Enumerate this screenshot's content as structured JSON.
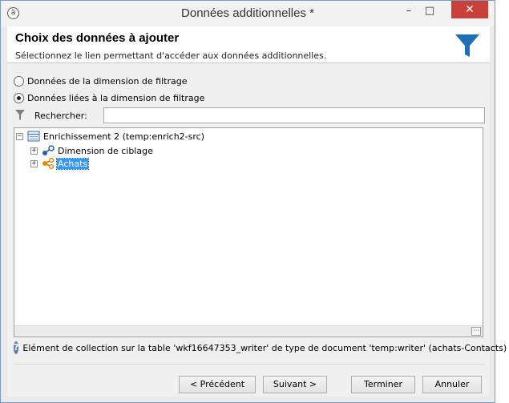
{
  "window": {
    "title": "Données additionnelles *",
    "app_icon": "adobe-campaign-icon"
  },
  "header": {
    "title": "Choix des données à ajouter",
    "subtitle": "Sélectionnez le lien permettant d'accéder aux données additionnelles.",
    "icon": "funnel-icon",
    "accent": "#1f6fb8"
  },
  "options": {
    "radio_1": "Données de la dimension de filtrage",
    "radio_2": "Données liées à la dimension de filtrage",
    "selected": "radio_2"
  },
  "search": {
    "label": "Rechercher:",
    "value": ""
  },
  "tree": {
    "root": {
      "label": "Enrichissement 2 (temp:enrich2-src)",
      "icon": "table-icon",
      "expanded": true
    },
    "children": [
      {
        "label": "Dimension de ciblage",
        "icon": "link-icon",
        "expanded": false,
        "selected": false
      },
      {
        "label": "Achats",
        "icon": "collection-link-icon",
        "expanded": false,
        "selected": true
      }
    ]
  },
  "info": {
    "text": "Elément de collection sur la table 'wkf16647353_writer' de type de document 'temp:writer' (achats-Contacts)"
  },
  "buttons": {
    "previous": "< Précédent",
    "next": "Suivant >",
    "finish": "Terminer",
    "cancel": "Annuler"
  }
}
